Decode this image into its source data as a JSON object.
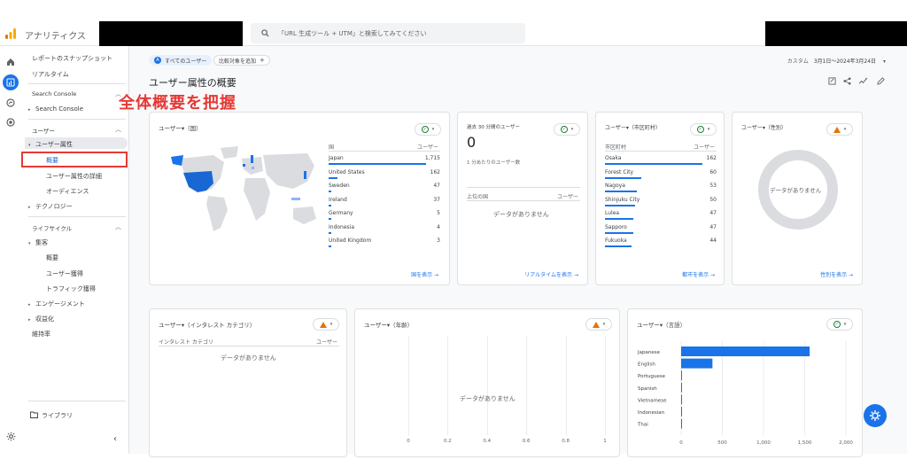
{
  "app": {
    "title": "アナリティクス"
  },
  "search": {
    "placeholder": "「URL 生成ツール + UTM」と検索してみてください"
  },
  "sidebar": {
    "snapshot": "レポートのスナップショット",
    "realtime": "リアルタイム",
    "search_console_head": "Search Console",
    "search_console_item": "Search Console",
    "user_head": "ユーザー",
    "user_attr": "ユーザー属性",
    "overview": "概要",
    "user_attr_detail": "ユーザー属性の詳細",
    "audience": "オーディエンス",
    "technology": "テクノロジー",
    "lifecycle_head": "ライフサイクル",
    "acquisition": "集客",
    "acq_overview": "概要",
    "user_acquisition": "ユーザー獲得",
    "traffic_acquisition": "トラフィック獲得",
    "engagement": "エンゲージメント",
    "monetization": "収益化",
    "retention": "維持率",
    "library": "ライブラリ"
  },
  "annotation": {
    "text": "全体概要を把握",
    "color": "#e53935"
  },
  "header": {
    "all_users_chip": "すべてのユーザー",
    "compare_chip": "比較対象を追加",
    "date_label": "カスタム",
    "date_range": "3月1日～2024年3月24日",
    "page_title": "ユーザー属性の概要"
  },
  "cards": {
    "country": {
      "title": "ユーザー▾（国）",
      "col_dim": "国",
      "col_metric": "ユーザー",
      "rows": [
        {
          "name": "Japan",
          "value": "1,715",
          "frac": 1.0
        },
        {
          "name": "United States",
          "value": "162",
          "frac": 0.094
        },
        {
          "name": "Sweden",
          "value": "47",
          "frac": 0.027
        },
        {
          "name": "Ireland",
          "value": "37",
          "frac": 0.022
        },
        {
          "name": "Germany",
          "value": "5",
          "frac": 0.003
        },
        {
          "name": "Indonesia",
          "value": "4",
          "frac": 0.002
        },
        {
          "name": "United Kingdom",
          "value": "3",
          "frac": 0.002
        }
      ],
      "link": "国を表示 →"
    },
    "realtime": {
      "title": "過去 30 分間のユーザー",
      "value": "0",
      "sub": "1 分あたりのユーザー数",
      "col_dim": "上位の国",
      "col_metric": "ユーザー",
      "nodata": "データがありません",
      "link": "リアルタイムを表示 →"
    },
    "city": {
      "title": "ユーザー▾（市区町村）",
      "col_dim": "市区町村",
      "col_metric": "ユーザー",
      "rows": [
        {
          "name": "Osaka",
          "value": "162",
          "frac": 1.0
        },
        {
          "name": "Forest City",
          "value": "60",
          "frac": 0.37
        },
        {
          "name": "Nagoya",
          "value": "53",
          "frac": 0.33
        },
        {
          "name": "Shinjuku City",
          "value": "50",
          "frac": 0.31
        },
        {
          "name": "Lulea",
          "value": "47",
          "frac": 0.29
        },
        {
          "name": "Sapporo",
          "value": "47",
          "frac": 0.29
        },
        {
          "name": "Fukuoka",
          "value": "44",
          "frac": 0.27
        }
      ],
      "link": "都市を表示 →"
    },
    "gender": {
      "title": "ユーザー▾（性別）",
      "nodata": "データがありません",
      "link": "性別を表示 →"
    },
    "interest": {
      "title": "ユーザー▾（インタレスト カテゴリ）",
      "col_dim": "インタレスト カテゴリ",
      "col_metric": "ユーザー",
      "nodata": "データがありません"
    },
    "age": {
      "title": "ユーザー▾（年齢）",
      "nodata": "データがありません",
      "ticks": [
        "0",
        "0.2",
        "0.4",
        "0.6",
        "0.8",
        "1"
      ]
    },
    "language": {
      "title": "ユーザー▾（言語）"
    }
  },
  "chart_data": {
    "type": "bar",
    "orientation": "horizontal",
    "categories": [
      "Japanese",
      "English",
      "Portuguese",
      "Spanish",
      "Vietnamese",
      "Indonesian",
      "Thai"
    ],
    "values": [
      1560,
      380,
      8,
      6,
      4,
      3,
      2
    ],
    "xlim": [
      0,
      2000
    ],
    "xticks": [
      "0",
      "500",
      "1,000",
      "1,500",
      "2,000"
    ],
    "color": "#1a73e8"
  }
}
